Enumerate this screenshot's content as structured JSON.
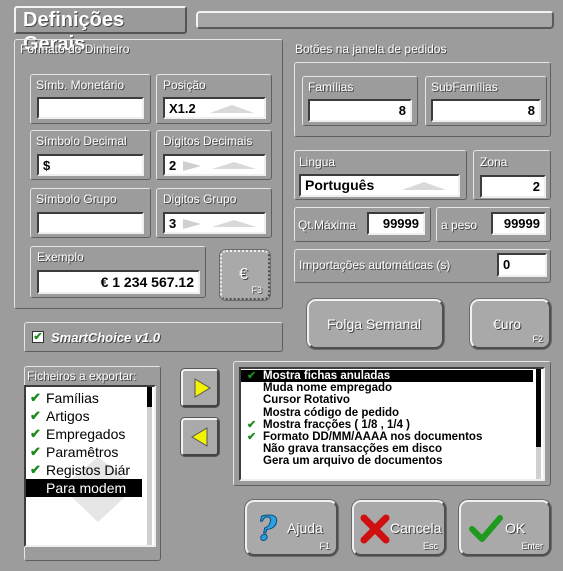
{
  "window": {
    "title": "Definições Gerais"
  },
  "money_format": {
    "section_title": "Formato do Dinheiro",
    "simb_monetario": {
      "label": "Símb. Monetário",
      "value": ""
    },
    "posicao": {
      "label": "Posição",
      "value": "X1.2"
    },
    "simbolo_decimal": {
      "label": "Símbolo Decimal",
      "value": "$"
    },
    "digitos_decimais": {
      "label": "Digitos Decimais",
      "value": "2"
    },
    "simbolo_grupo": {
      "label": "Símbolo Grupo",
      "value": ""
    },
    "digitos_grupo": {
      "label": "Digitos Grupo",
      "value": "3"
    },
    "exemplo": {
      "label": "Exemplo",
      "value": "€ 1 234 567.12"
    },
    "euro_button": {
      "label": "€",
      "shortcut": "F3"
    }
  },
  "order_buttons": {
    "section_title": "Botões na janela de pedidos",
    "familias": {
      "label": "Famílias",
      "value": "8"
    },
    "subfamilias": {
      "label": "SubFamílias",
      "value": "8"
    }
  },
  "language": {
    "label": "Lingua",
    "value": "Português"
  },
  "zone": {
    "label": "Zona",
    "value": "2"
  },
  "qt_maxima": {
    "label": "Qt.Máxima",
    "value": "99999"
  },
  "a_peso": {
    "label": "a peso",
    "value": "99999"
  },
  "importacoes": {
    "label": "Importações automáticas (s)",
    "value": "0"
  },
  "buttons": {
    "folga": {
      "label": "Folga Semanal"
    },
    "euro": {
      "label": "€uro",
      "shortcut": "F2"
    },
    "ajuda": {
      "label": "Ajuda",
      "shortcut": "F1"
    },
    "cancela": {
      "label": "Cancela",
      "shortcut": "Esc"
    },
    "ok": {
      "label": "OK",
      "shortcut": "Enter"
    }
  },
  "smartchoice": {
    "label": "SmartChoice v1.0",
    "checked": true
  },
  "export": {
    "title": "Ficheiros a exportar:",
    "items": [
      {
        "label": "Famílias",
        "checked": true
      },
      {
        "label": "Artigos",
        "checked": true
      },
      {
        "label": "Empregados",
        "checked": true
      },
      {
        "label": "Paramêtros",
        "checked": true
      },
      {
        "label": "Registos Diár",
        "checked": true
      },
      {
        "label": "Para modem",
        "checked": false,
        "selected": true
      }
    ]
  },
  "options": {
    "items": [
      {
        "label": "Mostra fichas anuladas",
        "checked": true,
        "selected": true
      },
      {
        "label": "Muda nome empregado",
        "checked": false
      },
      {
        "label": "Cursor Rotativo",
        "checked": false
      },
      {
        "label": "Mostra código de pedido",
        "checked": false
      },
      {
        "label": "Mostra fracções ( 1/8 , 1/4 )",
        "checked": true
      },
      {
        "label": "Formato DD/MM/AAAA nos documentos",
        "checked": true
      },
      {
        "label": "Não grava transacções em disco",
        "checked": false
      },
      {
        "label": "Gera um arquivo de documentos",
        "checked": false
      }
    ]
  },
  "colors": {
    "arrow": "#f3f300",
    "check": "#1c8c1c",
    "help_icon": "#2aa0e0",
    "cancel_icon": "#d01010",
    "ok_icon": "#1f9a1f"
  }
}
